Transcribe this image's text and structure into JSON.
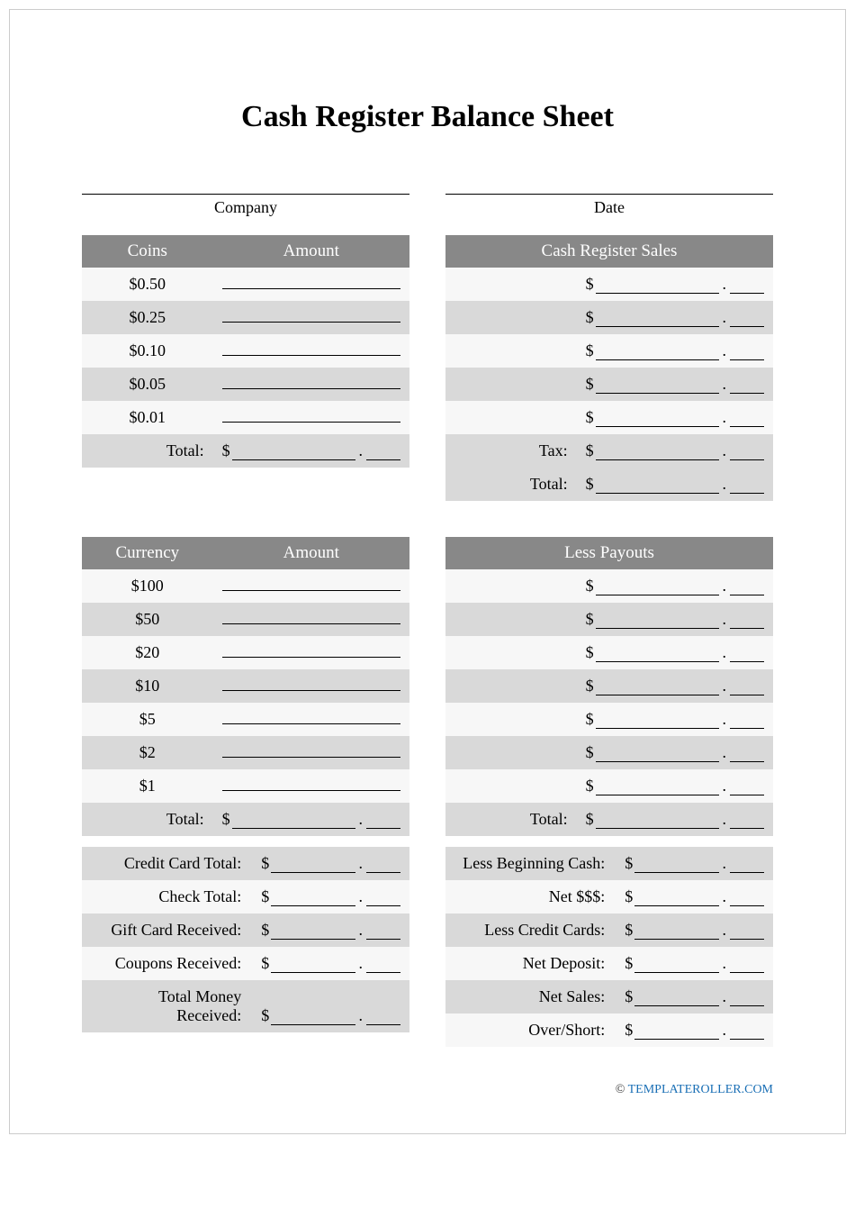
{
  "title": "Cash Register Balance Sheet",
  "header_fields": {
    "company": "Company",
    "date": "Date"
  },
  "coins": {
    "headers": {
      "col1": "Coins",
      "col2": "Amount"
    },
    "rows": [
      "$0.50",
      "$0.25",
      "$0.10",
      "$0.05",
      "$0.01"
    ],
    "total_label": "Total:"
  },
  "sales": {
    "header": "Cash Register Sales",
    "rows_count": 5,
    "tax_label": "Tax:",
    "total_label": "Total:"
  },
  "currency": {
    "headers": {
      "col1": "Currency",
      "col2": "Amount"
    },
    "rows": [
      "$100",
      "$50",
      "$20",
      "$10",
      "$5",
      "$2",
      "$1"
    ],
    "total_label": "Total:"
  },
  "payouts": {
    "header": "Less Payouts",
    "rows_count": 7,
    "total_label": "Total:"
  },
  "bottom_left": [
    "Credit Card Total:",
    "Check Total:",
    "Gift Card Received:",
    "Coupons Received:",
    "Total Money Received:"
  ],
  "bottom_right": [
    "Less Beginning Cash:",
    "Net $$$:",
    "Less Credit Cards:",
    "Net Deposit:",
    "Net Sales:",
    "Over/Short:"
  ],
  "footer": {
    "copyright": "©",
    "link_text": "TEMPLATEROLLER.COM"
  },
  "dollar": "$"
}
